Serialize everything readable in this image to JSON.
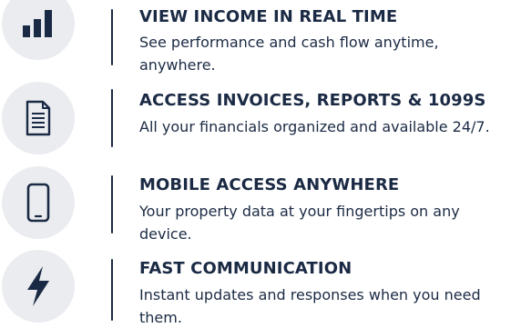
{
  "features": [
    {
      "icon": "bar-chart-icon",
      "title": "VIEW INCOME IN REAL TIME",
      "description": "See performance and cash flow anytime, anywhere."
    },
    {
      "icon": "document-icon",
      "title": "ACCESS INVOICES, REPORTS & 1099S",
      "description": "All your financials organized and available 24/7."
    },
    {
      "icon": "mobile-phone-icon",
      "title": "MOBILE ACCESS ANYWHERE",
      "description": "Your property data at your fingertips on any device."
    },
    {
      "icon": "lightning-bolt-icon",
      "title": "FAST COMMUNICATION",
      "description": "Instant updates and responses when you need them."
    }
  ],
  "colors": {
    "text": "#1b2a44",
    "icon_background": "#eaecf0"
  }
}
